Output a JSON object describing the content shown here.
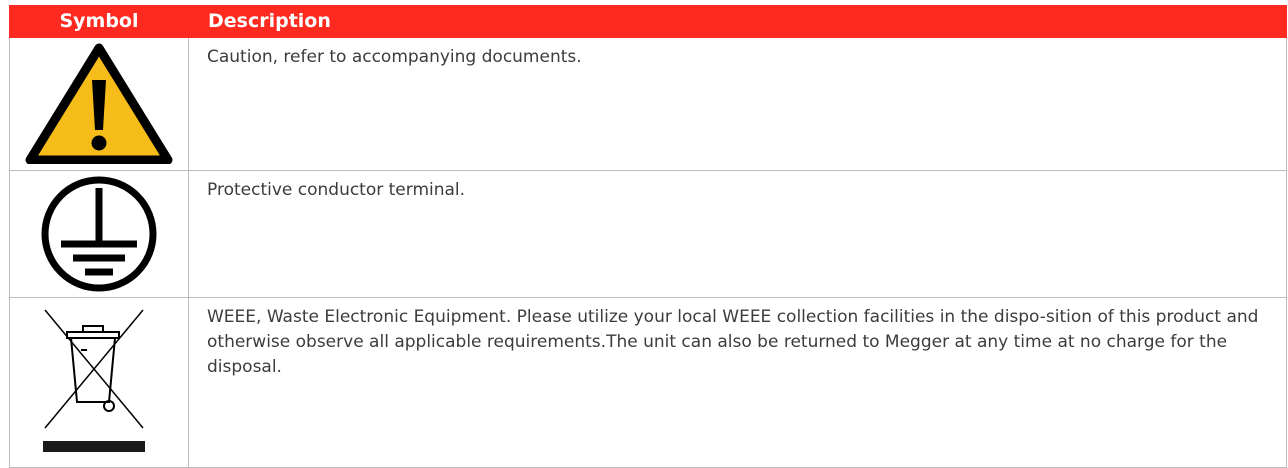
{
  "header": {
    "symbol": "Symbol",
    "description": "Description"
  },
  "rows": [
    {
      "icon": "caution-triangle-icon",
      "description": "Caution, refer to accompanying documents."
    },
    {
      "icon": "protective-earth-icon",
      "description": "Protective conductor terminal."
    },
    {
      "icon": "weee-crossed-bin-icon",
      "description": "WEEE, Waste Electronic Equipment. Please utilize your local WEEE collection facilities in the dispo-sition of this product and otherwise observe all applicable requirements.The unit can also be returned to Megger at any time at no charge for the disposal."
    }
  ],
  "colors": {
    "header_bg": "#ff2a1f",
    "caution_yellow": "#f6bd1a",
    "text": "#3c3c3c",
    "border": "#bdbdbd"
  }
}
